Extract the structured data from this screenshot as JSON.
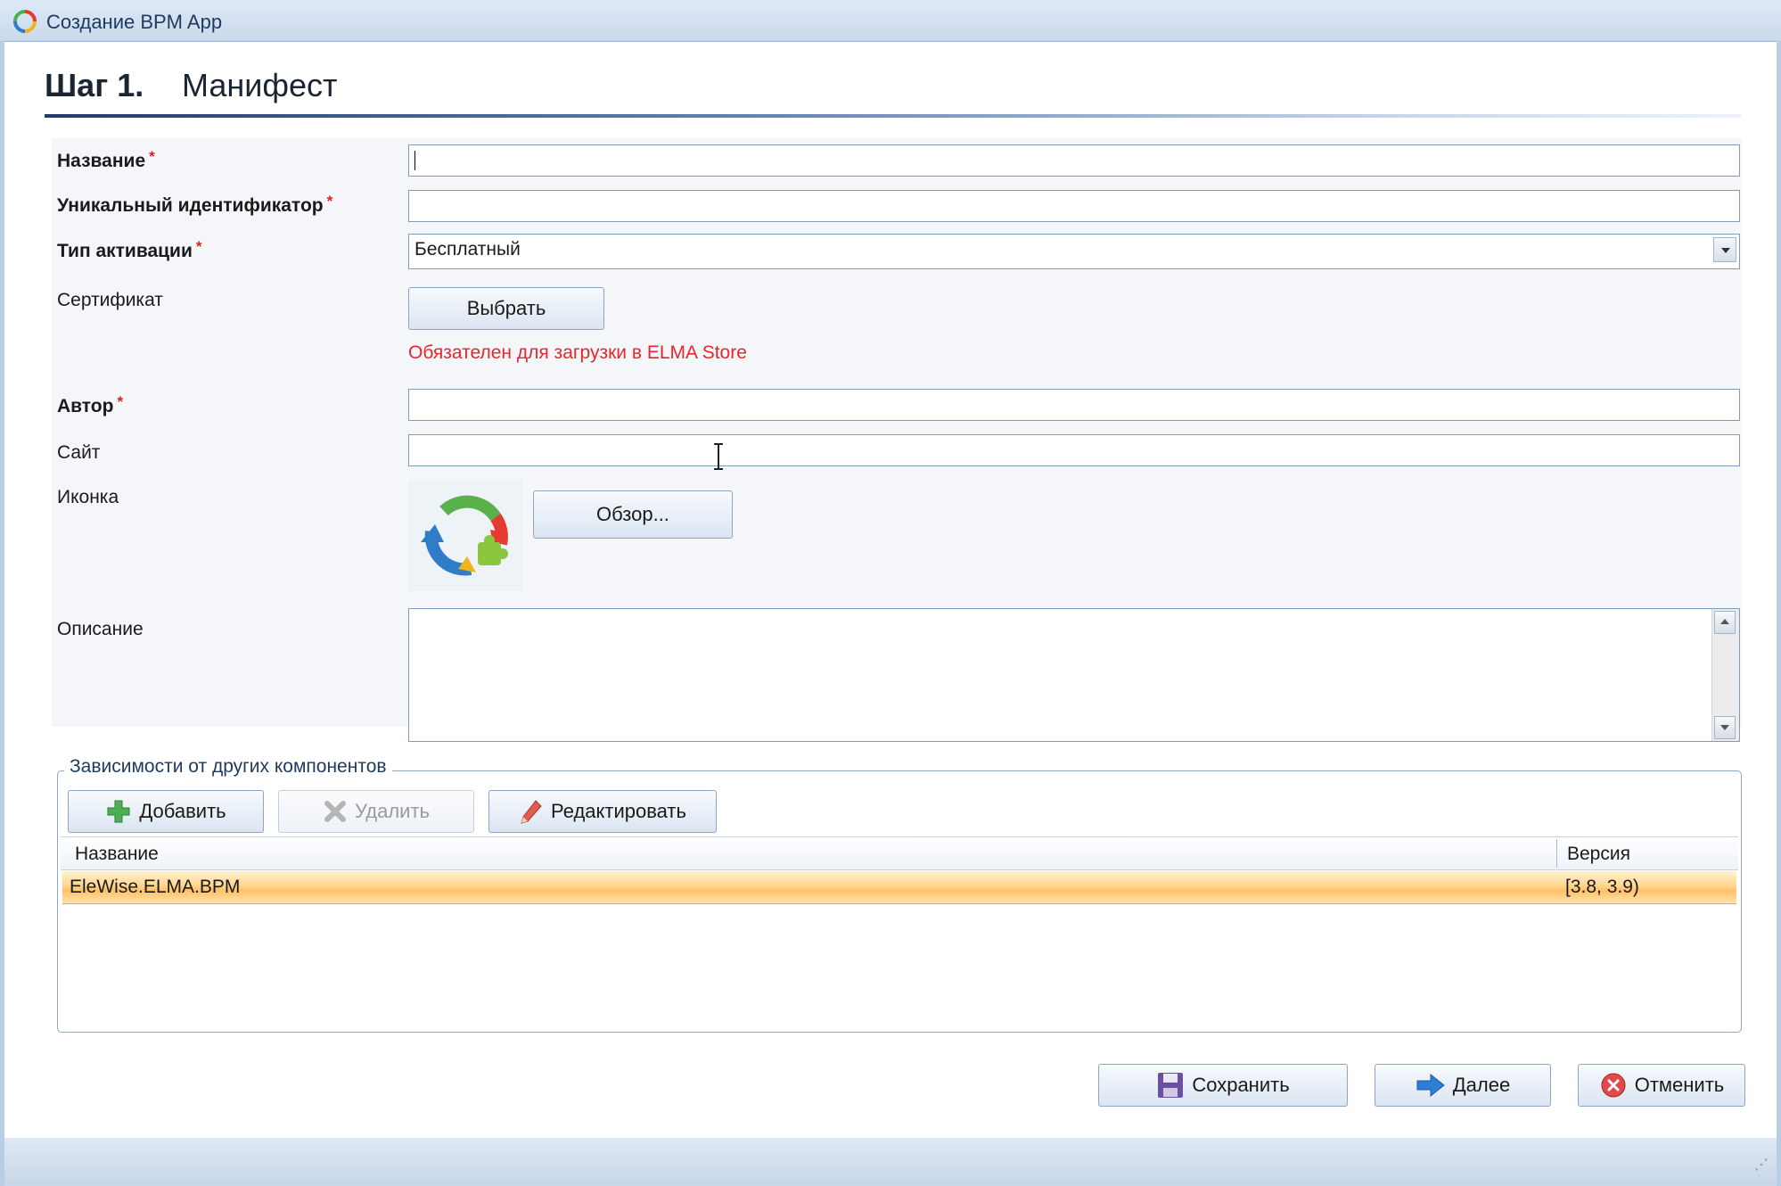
{
  "window": {
    "title": "Создание BPM App"
  },
  "step": {
    "number": "Шаг 1.",
    "name": "Манифест"
  },
  "form": {
    "name_label": "Название",
    "name_value": "",
    "id_label": "Уникальный идентификатор",
    "id_value": "",
    "activation_label": "Тип активации",
    "activation_value": "Бесплатный",
    "certificate_label": "Сертификат",
    "certificate_button": "Выбрать",
    "certificate_hint": "Обязателен для загрузки в ELMA Store",
    "author_label": "Автор",
    "author_value": "",
    "site_label": "Сайт",
    "site_value": "",
    "icon_label": "Иконка",
    "icon_button": "Обзор...",
    "description_label": "Описание",
    "description_value": "",
    "required_mark": "*"
  },
  "dependencies": {
    "title": "Зависимости от других компонентов",
    "add_label": "Добавить",
    "delete_label": "Удалить",
    "edit_label": "Редактировать",
    "columns": [
      "Название",
      "Версия"
    ],
    "rows": [
      {
        "name": "EleWise.ELMA.BPM",
        "version": "[3.8, 3.9)"
      }
    ]
  },
  "footer": {
    "save_label": "Сохранить",
    "next_label": "Далее",
    "cancel_label": "Отменить"
  },
  "icons": {
    "app": "elma-app-icon",
    "add": "plus-icon",
    "delete": "x-icon",
    "edit": "pencil-icon",
    "save": "floppy-icon",
    "next": "arrow-right-icon",
    "cancel": "cancel-icon"
  },
  "colors": {
    "required": "#e02020",
    "hint": "#e8262b",
    "selected_row": "#ffc166",
    "accent": "#1f3d6b"
  }
}
